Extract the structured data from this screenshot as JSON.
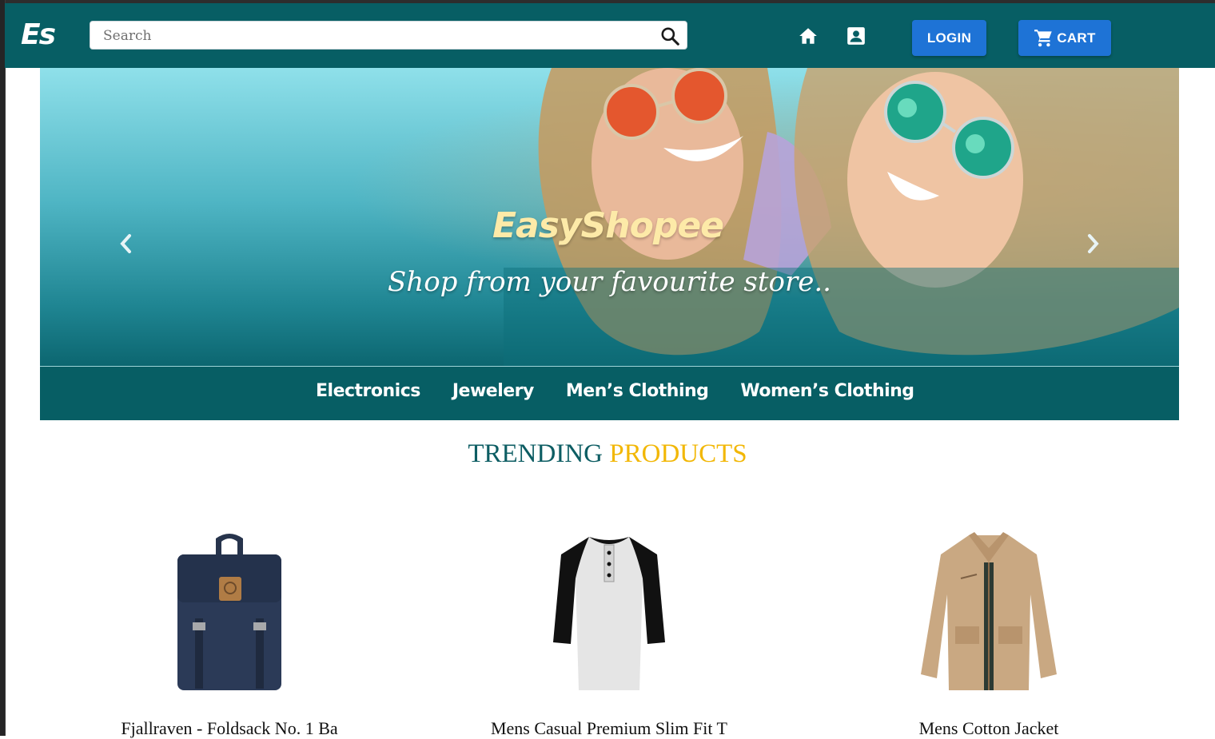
{
  "header": {
    "logo": "Es",
    "search_placeholder": "Search",
    "login_label": "LOGIN",
    "cart_label": "CART",
    "colors": {
      "bar": "#075e64",
      "button": "#1e73d6"
    }
  },
  "hero": {
    "title": "EasyShopee",
    "subtitle": "Shop from your favourite store.."
  },
  "categories": [
    {
      "label": "Electronics"
    },
    {
      "label": "Jewelery"
    },
    {
      "label": "Men’s Clothing"
    },
    {
      "label": "Women’s Clothing"
    }
  ],
  "trending": {
    "title_part1": "TRENDING",
    "title_part2": "PRODUCTS",
    "accent_color": "#f2b705",
    "products": [
      {
        "name": "Fjallraven - Foldsack No. 1 Ba",
        "image": "backpack-image"
      },
      {
        "name": "Mens Casual Premium Slim Fit T",
        "image": "raglan-tshirt-image"
      },
      {
        "name": "Mens Cotton Jacket",
        "image": "cotton-jacket-image"
      }
    ]
  }
}
